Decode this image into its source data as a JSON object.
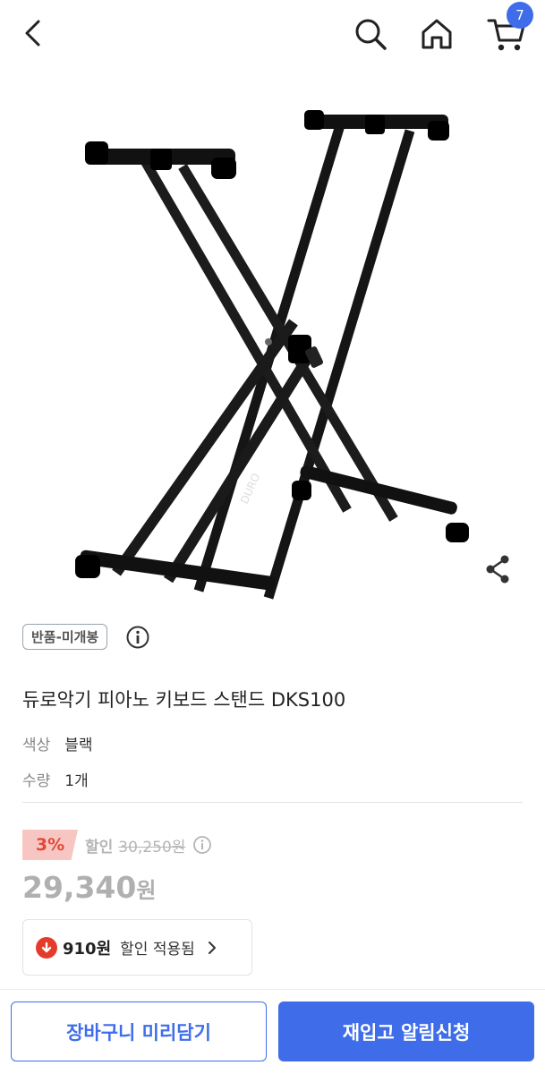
{
  "header": {
    "cart_count": "7",
    "icons": [
      "back-arrow-icon",
      "search-icon",
      "home-icon",
      "cart-icon"
    ]
  },
  "product": {
    "image_brand": "DURO",
    "return_badge": "반품-미개봉",
    "title": "듀로악기 피아노 키보드 스탠드 DKS100",
    "options": [
      {
        "key": "색상",
        "value": "블랙"
      },
      {
        "key": "수량",
        "value": "1개"
      }
    ]
  },
  "pricing": {
    "discount_pct": "3%",
    "discount_label": "할인",
    "original_price": "30,250원",
    "price_number": "29,340",
    "price_unit": "원",
    "coupon_amount": "910원",
    "coupon_text": "할인 적용됨"
  },
  "actions": {
    "cart_button": "장바구니 미리담기",
    "notify_button": "재입고 알림신청"
  },
  "colors": {
    "accent": "#3f6dea",
    "discount": "#e0493a",
    "badge_bg": "#f8c6c2"
  }
}
